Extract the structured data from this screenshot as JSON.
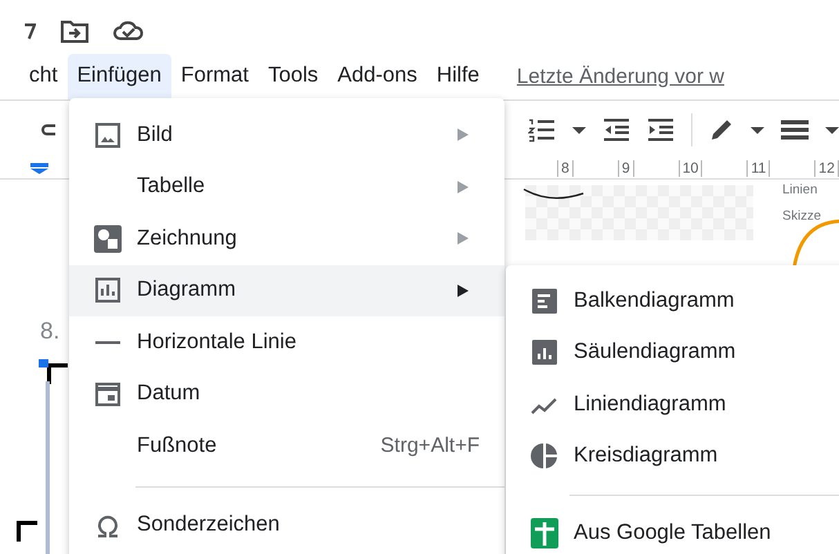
{
  "menubar": {
    "items": [
      {
        "label": "cht",
        "selected": false
      },
      {
        "label": "Einfügen",
        "selected": true
      },
      {
        "label": "Format",
        "selected": false
      },
      {
        "label": "Tools",
        "selected": false
      },
      {
        "label": "Add-ons",
        "selected": false
      },
      {
        "label": "Hilfe",
        "selected": false
      }
    ],
    "last_edit": "Letzte Änderung vor w"
  },
  "ruler": {
    "labels": [
      "8",
      "9",
      "10",
      "11",
      "12"
    ]
  },
  "document": {
    "list_number": "8.",
    "drawing_labels": [
      "Linien",
      "Skizze"
    ]
  },
  "insert_menu": {
    "items": [
      {
        "kind": "item",
        "label": "Bild",
        "submenu": true,
        "selected": false
      },
      {
        "kind": "item",
        "label": "Tabelle",
        "submenu": true,
        "selected": false
      },
      {
        "kind": "item",
        "label": "Zeichnung",
        "submenu": true,
        "selected": false
      },
      {
        "kind": "item",
        "label": "Diagramm",
        "submenu": true,
        "selected": true
      },
      {
        "kind": "item",
        "label": "Horizontale Linie",
        "submenu": false,
        "selected": false
      },
      {
        "kind": "item",
        "label": "Datum",
        "submenu": false,
        "selected": false
      },
      {
        "kind": "item",
        "label": "Fußnote",
        "shortcut": "Strg+Alt+F",
        "submenu": false,
        "selected": false
      },
      {
        "kind": "separator"
      },
      {
        "kind": "item",
        "label": "Sonderzeichen",
        "submenu": false,
        "selected": false
      }
    ]
  },
  "chart_submenu": {
    "items": [
      {
        "kind": "item",
        "label": "Balkendiagramm"
      },
      {
        "kind": "item",
        "label": "Säulendiagramm"
      },
      {
        "kind": "item",
        "label": "Liniendiagramm"
      },
      {
        "kind": "item",
        "label": "Kreisdiagramm"
      },
      {
        "kind": "separator"
      },
      {
        "kind": "item",
        "label": "Aus Google Tabellen"
      }
    ]
  }
}
